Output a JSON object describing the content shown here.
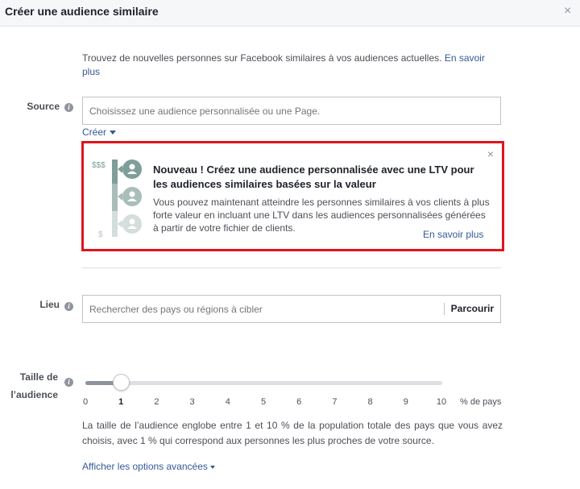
{
  "dialog": {
    "title": "Créer une audience similaire",
    "close_glyph": "×"
  },
  "intro": {
    "text": "Trouvez de nouvelles personnes sur Facebook similaires à vos audiences actuelles.",
    "link_part1": "En savoir",
    "link_part2": "plus"
  },
  "source": {
    "label": "Source",
    "placeholder": "Choisissez une audience personnalisée ou une Page.",
    "create_label": "Créer"
  },
  "promo": {
    "title": "Nouveau ! Créez une audience personnalisée avec une LTV pour les audiences similaires basées sur la valeur",
    "body": "Vous pouvez maintenant atteindre les personnes similaires à vos clients à plus forte valeur en incluant une LTV dans les audiences personnalisées générées à partir de votre fichier de clients.",
    "link": "En savoir plus",
    "graphic_high": "$$$",
    "graphic_low": "$",
    "close_glyph": "×"
  },
  "location": {
    "label": "Lieu",
    "placeholder": "Rechercher des pays ou régions à cibler",
    "browse_label": "Parcourir"
  },
  "audience_size": {
    "label_line1": "Taille de",
    "label_line2": "l’audience",
    "ticks": [
      "0",
      "1",
      "2",
      "3",
      "4",
      "5",
      "6",
      "7",
      "8",
      "9",
      "10"
    ],
    "unit": "% de pays",
    "selected_value": 1,
    "min": 0,
    "max": 10,
    "description": "La taille de l’audience englobe entre 1 et 10 % de la population totale des pays que vous avez choisis, avec 1 % qui correspond aux personnes les plus proches de votre source."
  },
  "advanced": {
    "label": "Afficher les options avancées"
  },
  "colors": {
    "link": "#365899",
    "highlight_border": "#e0141c",
    "graphic_teal": "#7f9e9a"
  }
}
